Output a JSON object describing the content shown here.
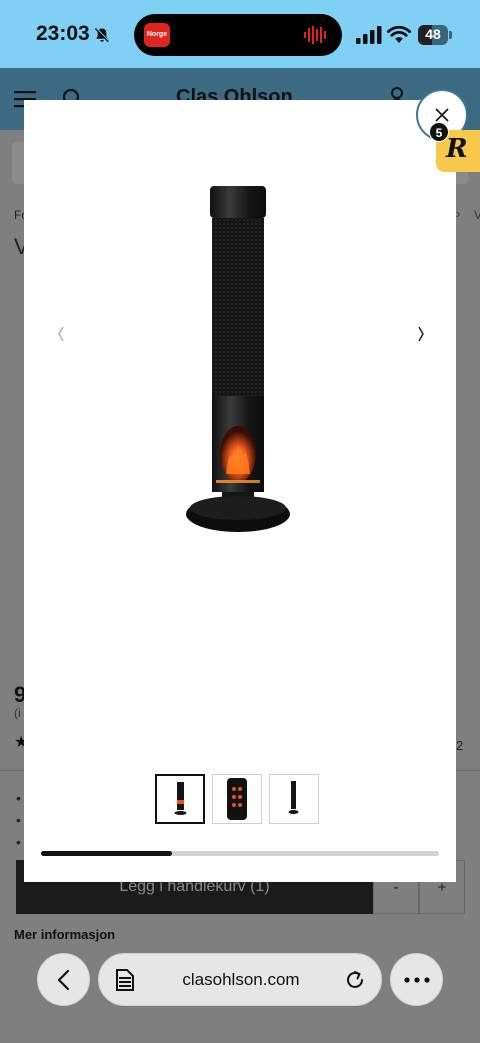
{
  "status_bar": {
    "time": "23:03",
    "battery_level": "48",
    "island_app_label": "Norge"
  },
  "site_header": {
    "logo_text": "Clas Ohlson"
  },
  "background_page": {
    "breadcrumb_start": "Fo",
    "breadcrumb_chevron": "›",
    "breadcrumb_end": "V",
    "title_start": "V",
    "price_start": "9",
    "price_note_start": "(i",
    "rating_count_end": "2",
    "bullets": [
      "•",
      "•",
      "•"
    ],
    "add_to_cart_label": "Legg i handlekurv (1)",
    "quantity_minus": "-",
    "quantity_plus": "+",
    "more_info_label": "Mer informasjon"
  },
  "gallery": {
    "progress": 0.33,
    "thumbnails": [
      {
        "name": "tower heater front",
        "active": true
      },
      {
        "name": "remote control",
        "active": false
      },
      {
        "name": "tower heater side",
        "active": false
      }
    ]
  },
  "extension": {
    "letter": "R",
    "count": "5"
  },
  "browser": {
    "address": "clasohlson.com"
  },
  "colors": {
    "status_bar_bg": "#7fd0f4",
    "header_bg": "#3c6a82",
    "extension_bg": "#f7c84b",
    "flame": "#e8551e"
  }
}
